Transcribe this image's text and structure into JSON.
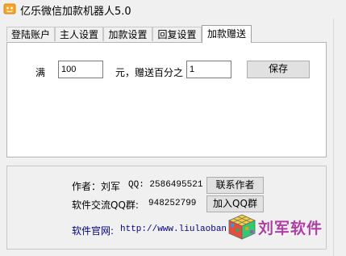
{
  "window": {
    "title": "亿乐微信加款机器人5.0"
  },
  "tabs": [
    {
      "label": "登陆账户",
      "active": false
    },
    {
      "label": "主人设置",
      "active": false
    },
    {
      "label": "加款设置",
      "active": false
    },
    {
      "label": "回复设置",
      "active": false
    },
    {
      "label": "加款赠送",
      "active": true
    }
  ],
  "bonus": {
    "man_label": "满",
    "amount_value": "100",
    "percent_label": "元，赠送百分之",
    "percent_value": "1",
    "save_label": "保存"
  },
  "info": {
    "author_text": "作者：刘军",
    "qq_text": "QQ: 2586495521",
    "contact_label": "联系作者",
    "group_label_text": "软件交流QQ群:",
    "group_number": "948252799",
    "join_label": "加入QQ群",
    "website_label": "软件官网:",
    "website_url": "http://www.liulaoban.vi"
  },
  "branding": {
    "logo_text": "刘军软件",
    "logo_color": "#b43aa6"
  }
}
